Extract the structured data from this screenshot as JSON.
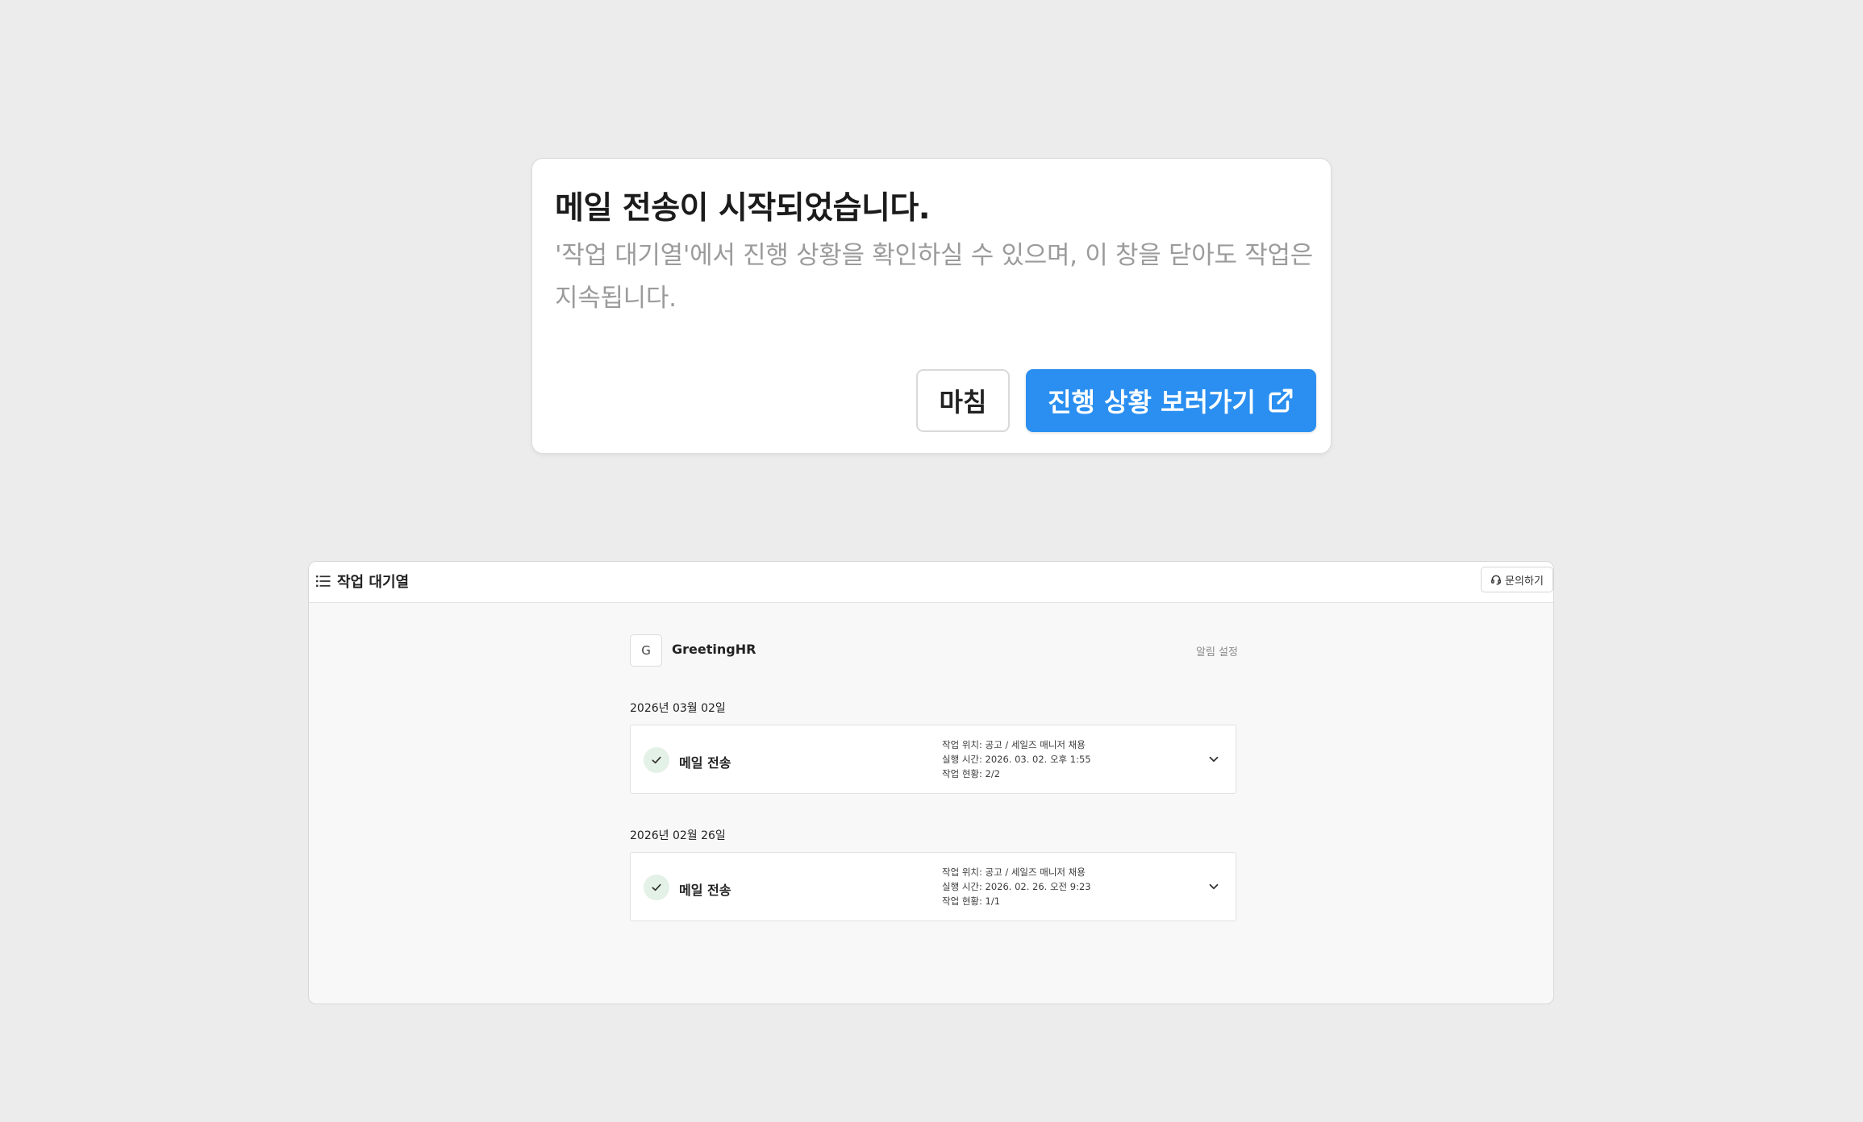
{
  "modal": {
    "title": "메일 전송이 시작되었습니다.",
    "description": "'작업 대기열'에서 진행 상황을 확인하실 수 있으며, 이 창을 닫아도 작업은 지속됩니다.",
    "close_label": "마침",
    "progress_label": "진행 상황 보러가기",
    "progress_icon": "external-link-icon",
    "accent_color": "#2a8ff0"
  },
  "queue": {
    "title": "작업 대기열",
    "title_icon": "list-icon",
    "help_label": "문의하기",
    "help_icon": "headset-icon",
    "org": {
      "initial": "G",
      "name": "GreetingHR"
    },
    "notification_label": "알림 설정",
    "groups": [
      {
        "date": "2026년 03월 02일",
        "job": {
          "title": "메일 전송",
          "status_icon": "check-icon",
          "location": "작업 위치: 공고 / 세일즈 매니저 채용",
          "run_time": "실행 시간: 2026. 03. 02. 오후 1:55",
          "status": "작업 현황: 2/2"
        }
      },
      {
        "date": "2026년 02월 26일",
        "job": {
          "title": "메일 전송",
          "status_icon": "check-icon",
          "location": "작업 위치: 공고 / 세일즈 매니저 채용",
          "run_time": "실행 시간: 2026. 02. 26. 오전 9:23",
          "status": "작업 현황: 1/1"
        }
      }
    ]
  }
}
